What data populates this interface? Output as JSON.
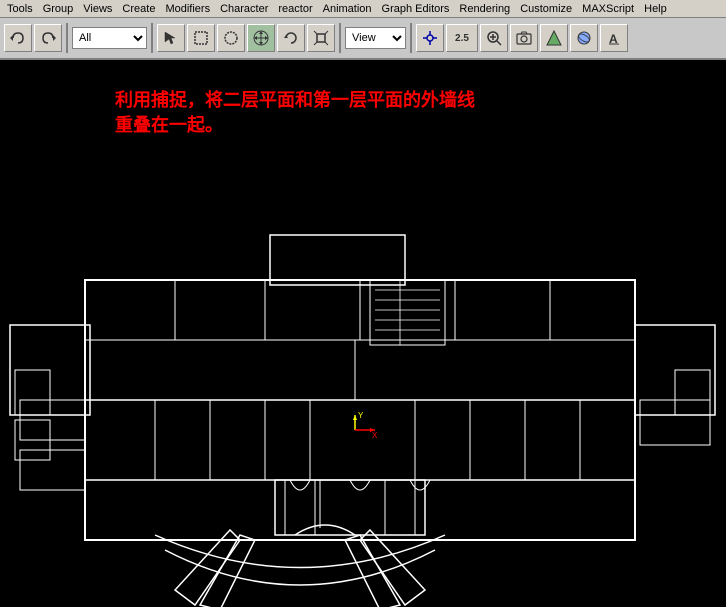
{
  "menubar": {
    "items": [
      "Tools",
      "Group",
      "Views",
      "Create",
      "Modifiers",
      "Character",
      "reactor",
      "Animation",
      "Graph Editors",
      "Rendering",
      "Customize",
      "MAXScript",
      "Help"
    ]
  },
  "toolbar": {
    "dropdown_value": "All",
    "view_value": "View",
    "zoom_value": "2.5"
  },
  "annotation": {
    "line1": "利用捕捉，将二层平面和第一层平面的外墙线",
    "line2": "重叠在一起。"
  },
  "viewport": {
    "background_color": "#000000"
  }
}
